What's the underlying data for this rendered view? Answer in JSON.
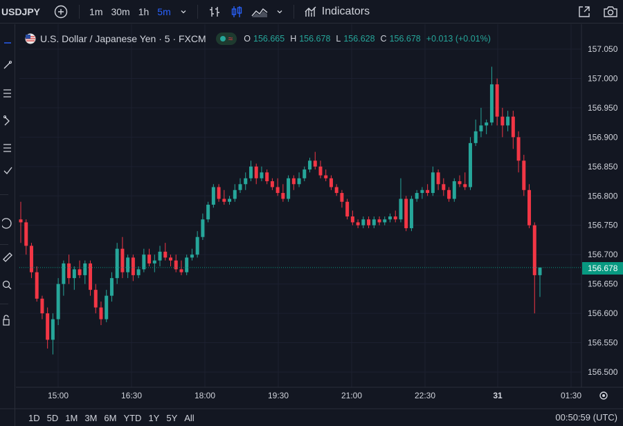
{
  "toolbar": {
    "symbol": "USDJPY",
    "intervals": [
      "1m",
      "30m",
      "1h",
      "5m"
    ],
    "active_interval": "5m",
    "indicators_label": "Indicators"
  },
  "legend": {
    "title": "U.S. Dollar / Japanese Yen · 5 · FXCM",
    "o_key": "O",
    "o_val": "156.665",
    "h_key": "H",
    "h_val": "156.678",
    "l_key": "L",
    "l_val": "156.628",
    "c_key": "C",
    "c_val": "156.678",
    "change": "+0.013 (+0.01%)"
  },
  "price_axis": {
    "labels": [
      "157.050",
      "157.000",
      "156.950",
      "156.900",
      "156.850",
      "156.800",
      "156.750",
      "156.700",
      "156.650",
      "156.600",
      "156.550",
      "156.500"
    ],
    "current_price": "156.678"
  },
  "time_axis": {
    "labels": [
      "15:00",
      "16:30",
      "18:00",
      "19:30",
      "21:00",
      "22:30",
      "31",
      "01:30"
    ]
  },
  "ranges": [
    "1D",
    "5D",
    "1M",
    "3M",
    "6M",
    "YTD",
    "1Y",
    "5Y",
    "All"
  ],
  "clock": "00:50:59 (UTC)",
  "colors": {
    "up": "#26a69a",
    "down": "#f23645",
    "background": "#131722",
    "accent": "#2962ff"
  },
  "chart_data": {
    "type": "candlestick",
    "symbol": "USDJPY",
    "ylim": [
      156.48,
      157.07
    ],
    "candles": [
      {
        "o": 156.76,
        "h": 156.79,
        "l": 156.72,
        "c": 156.755
      },
      {
        "o": 156.755,
        "h": 156.76,
        "l": 156.7,
        "c": 156.715
      },
      {
        "o": 156.715,
        "h": 156.72,
        "l": 156.66,
        "c": 156.67
      },
      {
        "o": 156.67,
        "h": 156.68,
        "l": 156.62,
        "c": 156.625
      },
      {
        "o": 156.625,
        "h": 156.63,
        "l": 156.59,
        "c": 156.6
      },
      {
        "o": 156.6,
        "h": 156.61,
        "l": 156.54,
        "c": 156.555
      },
      {
        "o": 156.555,
        "h": 156.6,
        "l": 156.53,
        "c": 156.59
      },
      {
        "o": 156.59,
        "h": 156.66,
        "l": 156.58,
        "c": 156.65
      },
      {
        "o": 156.65,
        "h": 156.69,
        "l": 156.63,
        "c": 156.685
      },
      {
        "o": 156.685,
        "h": 156.7,
        "l": 156.65,
        "c": 156.66
      },
      {
        "o": 156.66,
        "h": 156.68,
        "l": 156.64,
        "c": 156.675
      },
      {
        "o": 156.675,
        "h": 156.69,
        "l": 156.66,
        "c": 156.665
      },
      {
        "o": 156.665,
        "h": 156.69,
        "l": 156.65,
        "c": 156.685
      },
      {
        "o": 156.685,
        "h": 156.69,
        "l": 156.63,
        "c": 156.64
      },
      {
        "o": 156.64,
        "h": 156.65,
        "l": 156.6,
        "c": 156.61
      },
      {
        "o": 156.61,
        "h": 156.62,
        "l": 156.58,
        "c": 156.59
      },
      {
        "o": 156.59,
        "h": 156.64,
        "l": 156.585,
        "c": 156.63
      },
      {
        "o": 156.63,
        "h": 156.67,
        "l": 156.62,
        "c": 156.66
      },
      {
        "o": 156.66,
        "h": 156.72,
        "l": 156.65,
        "c": 156.71
      },
      {
        "o": 156.71,
        "h": 156.73,
        "l": 156.66,
        "c": 156.67
      },
      {
        "o": 156.67,
        "h": 156.7,
        "l": 156.66,
        "c": 156.695
      },
      {
        "o": 156.695,
        "h": 156.7,
        "l": 156.655,
        "c": 156.665
      },
      {
        "o": 156.665,
        "h": 156.68,
        "l": 156.66,
        "c": 156.675
      },
      {
        "o": 156.675,
        "h": 156.71,
        "l": 156.67,
        "c": 156.7
      },
      {
        "o": 156.7,
        "h": 156.71,
        "l": 156.68,
        "c": 156.685
      },
      {
        "o": 156.685,
        "h": 156.7,
        "l": 156.67,
        "c": 156.69
      },
      {
        "o": 156.69,
        "h": 156.715,
        "l": 156.68,
        "c": 156.705
      },
      {
        "o": 156.705,
        "h": 156.72,
        "l": 156.69,
        "c": 156.695
      },
      {
        "o": 156.695,
        "h": 156.7,
        "l": 156.68,
        "c": 156.69
      },
      {
        "o": 156.69,
        "h": 156.7,
        "l": 156.67,
        "c": 156.675
      },
      {
        "o": 156.675,
        "h": 156.69,
        "l": 156.665,
        "c": 156.67
      },
      {
        "o": 156.67,
        "h": 156.7,
        "l": 156.665,
        "c": 156.695
      },
      {
        "o": 156.695,
        "h": 156.71,
        "l": 156.69,
        "c": 156.7
      },
      {
        "o": 156.7,
        "h": 156.74,
        "l": 156.695,
        "c": 156.73
      },
      {
        "o": 156.73,
        "h": 156.77,
        "l": 156.725,
        "c": 156.76
      },
      {
        "o": 156.76,
        "h": 156.79,
        "l": 156.755,
        "c": 156.785
      },
      {
        "o": 156.785,
        "h": 156.82,
        "l": 156.78,
        "c": 156.815
      },
      {
        "o": 156.815,
        "h": 156.82,
        "l": 156.79,
        "c": 156.795
      },
      {
        "o": 156.795,
        "h": 156.81,
        "l": 156.785,
        "c": 156.79
      },
      {
        "o": 156.79,
        "h": 156.8,
        "l": 156.785,
        "c": 156.795
      },
      {
        "o": 156.795,
        "h": 156.82,
        "l": 156.79,
        "c": 156.81
      },
      {
        "o": 156.81,
        "h": 156.83,
        "l": 156.805,
        "c": 156.82
      },
      {
        "o": 156.82,
        "h": 156.84,
        "l": 156.81,
        "c": 156.83
      },
      {
        "o": 156.83,
        "h": 156.86,
        "l": 156.825,
        "c": 156.85
      },
      {
        "o": 156.85,
        "h": 156.855,
        "l": 156.82,
        "c": 156.83
      },
      {
        "o": 156.83,
        "h": 156.85,
        "l": 156.825,
        "c": 156.84
      },
      {
        "o": 156.84,
        "h": 156.845,
        "l": 156.82,
        "c": 156.825
      },
      {
        "o": 156.825,
        "h": 156.83,
        "l": 156.81,
        "c": 156.815
      },
      {
        "o": 156.815,
        "h": 156.83,
        "l": 156.8,
        "c": 156.805
      },
      {
        "o": 156.805,
        "h": 156.82,
        "l": 156.79,
        "c": 156.795
      },
      {
        "o": 156.795,
        "h": 156.835,
        "l": 156.79,
        "c": 156.83
      },
      {
        "o": 156.83,
        "h": 156.835,
        "l": 156.81,
        "c": 156.82
      },
      {
        "o": 156.82,
        "h": 156.84,
        "l": 156.815,
        "c": 156.83
      },
      {
        "o": 156.83,
        "h": 156.85,
        "l": 156.825,
        "c": 156.845
      },
      {
        "o": 156.845,
        "h": 156.865,
        "l": 156.84,
        "c": 156.86
      },
      {
        "o": 156.86,
        "h": 156.875,
        "l": 156.845,
        "c": 156.85
      },
      {
        "o": 156.85,
        "h": 156.86,
        "l": 156.83,
        "c": 156.835
      },
      {
        "o": 156.835,
        "h": 156.845,
        "l": 156.825,
        "c": 156.83
      },
      {
        "o": 156.83,
        "h": 156.835,
        "l": 156.81,
        "c": 156.815
      },
      {
        "o": 156.815,
        "h": 156.82,
        "l": 156.8,
        "c": 156.805
      },
      {
        "o": 156.805,
        "h": 156.81,
        "l": 156.78,
        "c": 156.79
      },
      {
        "o": 156.79,
        "h": 156.795,
        "l": 156.76,
        "c": 156.765
      },
      {
        "o": 156.765,
        "h": 156.775,
        "l": 156.75,
        "c": 156.755
      },
      {
        "o": 156.755,
        "h": 156.76,
        "l": 156.745,
        "c": 156.75
      },
      {
        "o": 156.75,
        "h": 156.765,
        "l": 156.745,
        "c": 156.76
      },
      {
        "o": 156.76,
        "h": 156.765,
        "l": 156.745,
        "c": 156.75
      },
      {
        "o": 156.75,
        "h": 156.765,
        "l": 156.745,
        "c": 156.76
      },
      {
        "o": 156.76,
        "h": 156.765,
        "l": 156.75,
        "c": 156.755
      },
      {
        "o": 156.755,
        "h": 156.765,
        "l": 156.75,
        "c": 156.76
      },
      {
        "o": 156.76,
        "h": 156.77,
        "l": 156.755,
        "c": 156.765
      },
      {
        "o": 156.765,
        "h": 156.775,
        "l": 156.755,
        "c": 156.76
      },
      {
        "o": 156.76,
        "h": 156.83,
        "l": 156.755,
        "c": 156.795
      },
      {
        "o": 156.795,
        "h": 156.8,
        "l": 156.74,
        "c": 156.745
      },
      {
        "o": 156.745,
        "h": 156.8,
        "l": 156.74,
        "c": 156.795
      },
      {
        "o": 156.795,
        "h": 156.81,
        "l": 156.79,
        "c": 156.805
      },
      {
        "o": 156.805,
        "h": 156.815,
        "l": 156.795,
        "c": 156.81
      },
      {
        "o": 156.81,
        "h": 156.82,
        "l": 156.8,
        "c": 156.805
      },
      {
        "o": 156.805,
        "h": 156.85,
        "l": 156.8,
        "c": 156.84
      },
      {
        "o": 156.84,
        "h": 156.845,
        "l": 156.81,
        "c": 156.82
      },
      {
        "o": 156.82,
        "h": 156.83,
        "l": 156.8,
        "c": 156.81
      },
      {
        "o": 156.81,
        "h": 156.815,
        "l": 156.79,
        "c": 156.795
      },
      {
        "o": 156.795,
        "h": 156.83,
        "l": 156.79,
        "c": 156.825
      },
      {
        "o": 156.825,
        "h": 156.835,
        "l": 156.815,
        "c": 156.82
      },
      {
        "o": 156.82,
        "h": 156.84,
        "l": 156.81,
        "c": 156.815
      },
      {
        "o": 156.815,
        "h": 156.9,
        "l": 156.81,
        "c": 156.89
      },
      {
        "o": 156.89,
        "h": 156.93,
        "l": 156.885,
        "c": 156.91
      },
      {
        "o": 156.91,
        "h": 156.95,
        "l": 156.9,
        "c": 156.92
      },
      {
        "o": 156.92,
        "h": 156.93,
        "l": 156.905,
        "c": 156.925
      },
      {
        "o": 156.925,
        "h": 157.02,
        "l": 156.92,
        "c": 156.99
      },
      {
        "o": 156.99,
        "h": 157.0,
        "l": 156.92,
        "c": 156.935
      },
      {
        "o": 156.935,
        "h": 156.95,
        "l": 156.9,
        "c": 156.92
      },
      {
        "o": 156.92,
        "h": 156.945,
        "l": 156.91,
        "c": 156.935
      },
      {
        "o": 156.935,
        "h": 156.945,
        "l": 156.88,
        "c": 156.9
      },
      {
        "o": 156.9,
        "h": 156.91,
        "l": 156.84,
        "c": 156.86
      },
      {
        "o": 156.86,
        "h": 156.87,
        "l": 156.8,
        "c": 156.81
      },
      {
        "o": 156.81,
        "h": 156.82,
        "l": 156.745,
        "c": 156.75
      },
      {
        "o": 156.75,
        "h": 156.755,
        "l": 156.6,
        "c": 156.665
      },
      {
        "o": 156.665,
        "h": 156.678,
        "l": 156.628,
        "c": 156.678
      }
    ]
  }
}
